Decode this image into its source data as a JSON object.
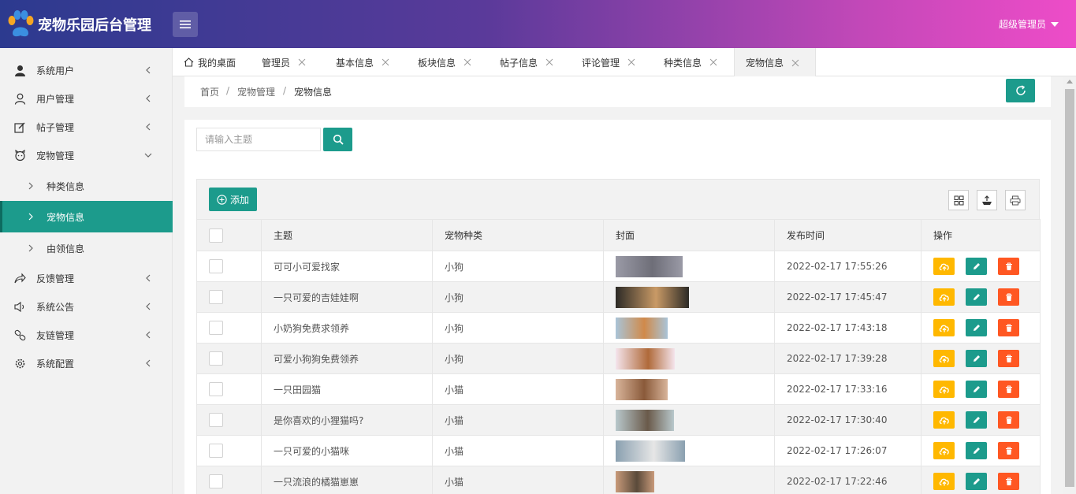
{
  "app": {
    "title": "宠物乐园后台管理",
    "user": "超级管理员"
  },
  "sidebar": {
    "items": [
      {
        "label": "系统用户",
        "icon": "user-solid-icon"
      },
      {
        "label": "用户管理",
        "icon": "user-outline-icon"
      },
      {
        "label": "帖子管理",
        "icon": "edit-icon"
      },
      {
        "label": "宠物管理",
        "icon": "pet-icon",
        "expanded": true,
        "children": [
          {
            "label": "种类信息"
          },
          {
            "label": "宠物信息",
            "active": true
          },
          {
            "label": "由领信息"
          }
        ]
      },
      {
        "label": "反馈管理",
        "icon": "share-icon"
      },
      {
        "label": "系统公告",
        "icon": "speaker-icon"
      },
      {
        "label": "友链管理",
        "icon": "link-icon"
      },
      {
        "label": "系统配置",
        "icon": "gear-icon"
      }
    ]
  },
  "tabs": [
    {
      "label": "我的桌面",
      "icon": "home-icon"
    },
    {
      "label": "管理员"
    },
    {
      "label": "基本信息"
    },
    {
      "label": "板块信息"
    },
    {
      "label": "帖子信息"
    },
    {
      "label": "评论管理"
    },
    {
      "label": "种类信息"
    },
    {
      "label": "宠物信息",
      "active": true
    }
  ],
  "breadcrumb": [
    "首页",
    "宠物管理",
    "宠物信息"
  ],
  "search": {
    "placeholder": "请输入主题"
  },
  "toolbar": {
    "add_label": "添加"
  },
  "table": {
    "columns": [
      "主题",
      "宠物种类",
      "封面",
      "发布时间",
      "操作"
    ],
    "rows": [
      {
        "title": "可可小可爱找家",
        "type": "小狗",
        "time": "2022-02-17 17:55:26"
      },
      {
        "title": "一只可爱的吉娃娃啊",
        "type": "小狗",
        "time": "2022-02-17 17:45:47"
      },
      {
        "title": "小奶狗免费求领养",
        "type": "小狗",
        "time": "2022-02-17 17:43:18"
      },
      {
        "title": "可爱小狗狗免费领养",
        "type": "小狗",
        "time": "2022-02-17 17:39:28"
      },
      {
        "title": "一只田园猫",
        "type": "小猫",
        "time": "2022-02-17 17:33:16"
      },
      {
        "title": "是你喜欢的小狸猫吗?",
        "type": "小猫",
        "time": "2022-02-17 17:30:40"
      },
      {
        "title": "一只可爱的小猫咪",
        "type": "小猫",
        "time": "2022-02-17 17:26:07"
      },
      {
        "title": "一只流浪的橘猫崽崽",
        "type": "小猫",
        "time": "2022-02-17 17:22:46"
      }
    ]
  },
  "colors": {
    "primary": "#1c9b8c",
    "warn": "#ffb800",
    "danger": "#ff5722"
  }
}
